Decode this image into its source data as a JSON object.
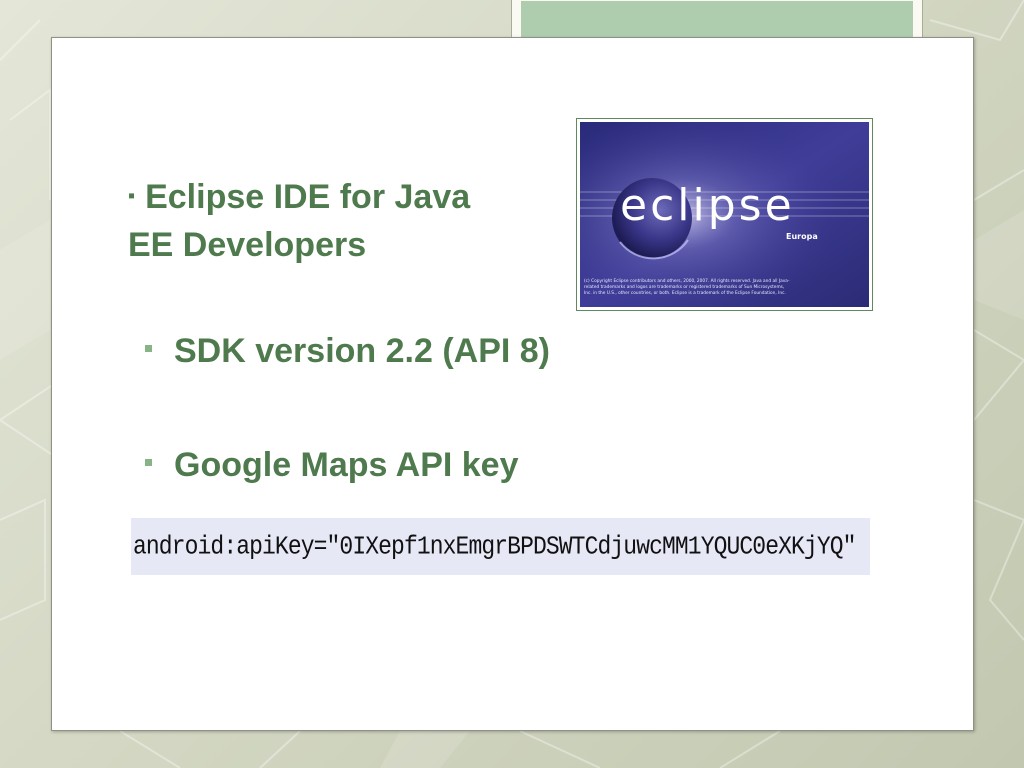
{
  "slide": {
    "heading": {
      "bullet": "▪",
      "line1": "Eclipse IDE for Java",
      "line2": "EE Developers"
    },
    "bullets": [
      {
        "text": "SDK version 2.2 (API 8)"
      },
      {
        "text": "Google Maps API key"
      }
    ],
    "code_snippet": "android:apiKey=\"0IXepf1nxEmgrBPDSWTCdjuwcMM1YQUC0eXKjYQ\"",
    "logo": {
      "wordmark": "eclipse",
      "edition": "Europa",
      "copyright_lines": [
        "(c) Copyright Eclipse contributors and others, 2000, 2007. All rights reserved. Java and all Java-",
        "related trademarks and logos are trademarks or registered trademarks of Sun Microsystems,",
        "Inc. in the U.S., other countries, or both. Eclipse is a trademark of the Eclipse Foundation, Inc."
      ]
    }
  },
  "colors": {
    "accent_green": "#4e7a4e",
    "bullet_green": "#86b486",
    "title_tab_green": "#aecdae",
    "logo_purple": "#3b3a93"
  }
}
